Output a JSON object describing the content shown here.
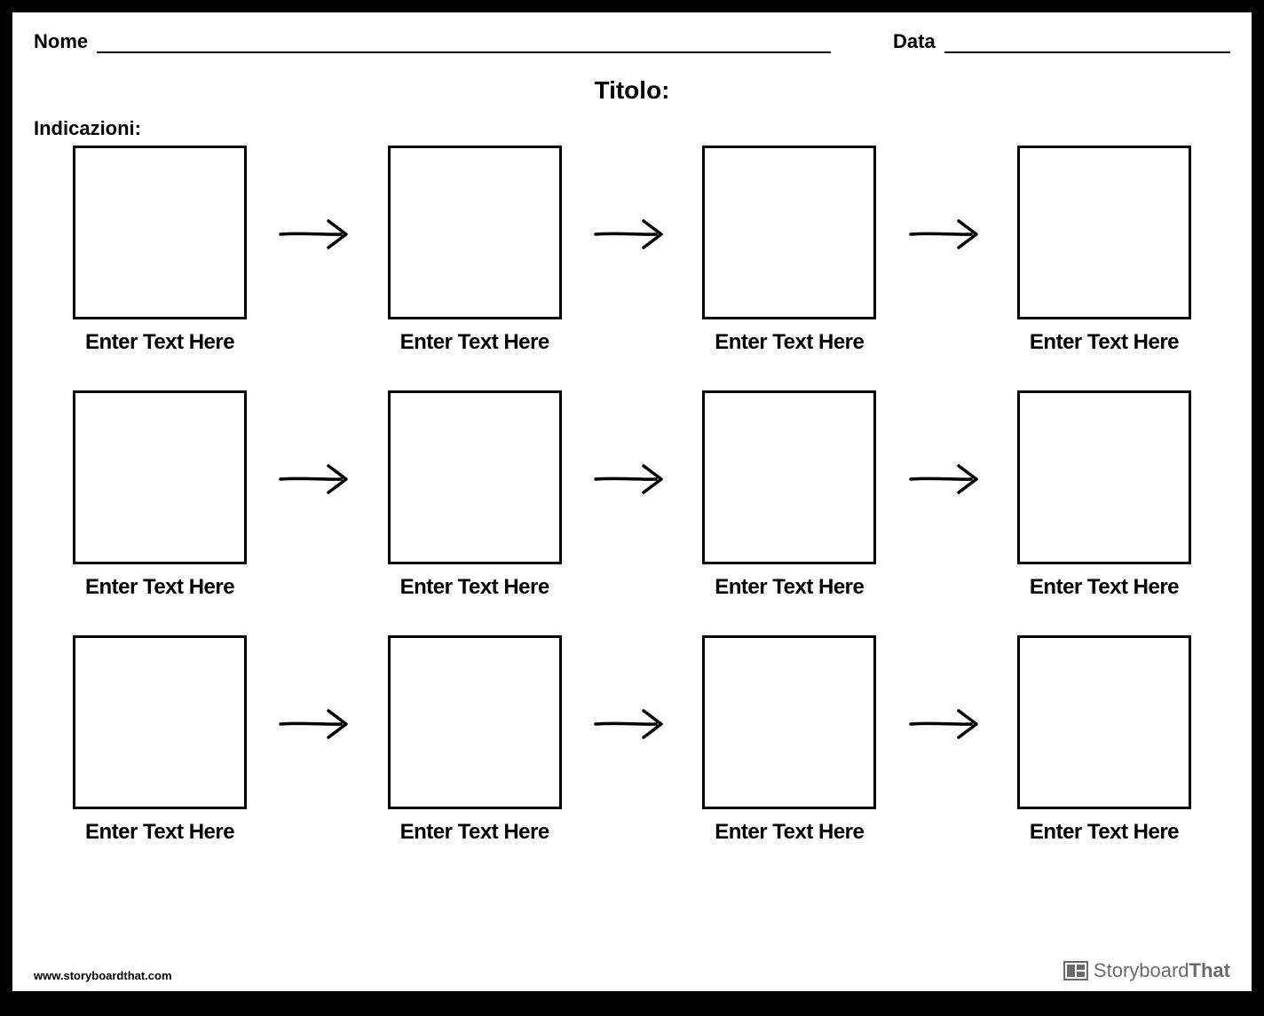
{
  "header": {
    "name_label": "Nome",
    "date_label": "Data"
  },
  "title": "Titolo:",
  "indications_label": "Indicazioni:",
  "rows": [
    {
      "cells": [
        {
          "caption": "Enter Text Here"
        },
        {
          "caption": "Enter Text Here"
        },
        {
          "caption": "Enter Text Here"
        },
        {
          "caption": "Enter Text Here"
        }
      ]
    },
    {
      "cells": [
        {
          "caption": "Enter Text Here"
        },
        {
          "caption": "Enter Text Here"
        },
        {
          "caption": "Enter Text Here"
        },
        {
          "caption": "Enter Text Here"
        }
      ]
    },
    {
      "cells": [
        {
          "caption": "Enter Text Here"
        },
        {
          "caption": "Enter Text Here"
        },
        {
          "caption": "Enter Text Here"
        },
        {
          "caption": "Enter Text Here"
        }
      ]
    }
  ],
  "footer": {
    "url": "www.storyboardthat.com",
    "brand_first": "Storyboard",
    "brand_second": "That"
  }
}
